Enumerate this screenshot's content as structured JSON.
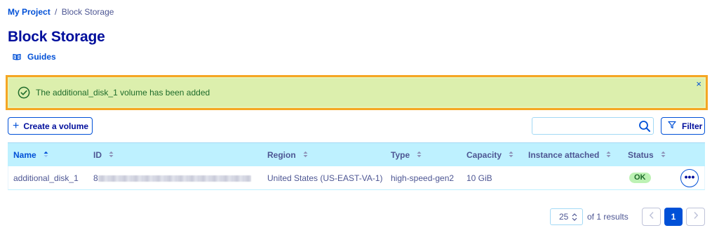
{
  "breadcrumb": {
    "project": "My Project",
    "separator": "/",
    "current": "Block Storage"
  },
  "page": {
    "title": "Block Storage",
    "guides_label": "Guides"
  },
  "alert": {
    "message": "The additional_disk_1 volume has been added",
    "close": "×",
    "type": "success",
    "highlight_color": "#f5a623"
  },
  "toolbar": {
    "create_label": "Create a volume",
    "create_icon": "+",
    "search_placeholder": "",
    "search_value": "",
    "filter_label": "Filter"
  },
  "table": {
    "columns": [
      "Name",
      "ID",
      "Region",
      "Type",
      "Capacity",
      "Instance attached",
      "Status"
    ],
    "sorted_column": "Name",
    "rows": [
      {
        "name": "additional_disk_1",
        "id_prefix": "8",
        "region": "United States (US-EAST-VA-1)",
        "type": "high-speed-gen2",
        "capacity": "10 GiB",
        "instance": "",
        "status": "OK",
        "actions_icon": "•••"
      }
    ]
  },
  "pagination": {
    "page_size": "25",
    "results_text": "of 1 results",
    "current_page": "1"
  },
  "colors": {
    "accent": "#0050d7",
    "title": "#000e9c",
    "header_bg": "#bef1ff",
    "success_bg": "#dcefad",
    "ok_badge": "#bdf2b4"
  }
}
